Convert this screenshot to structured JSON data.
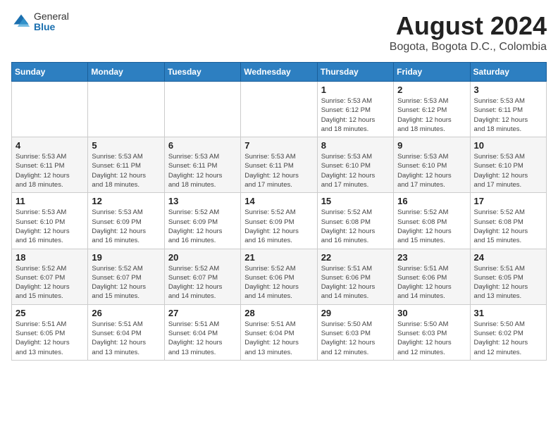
{
  "header": {
    "logo_general": "General",
    "logo_blue": "Blue",
    "main_title": "August 2024",
    "subtitle": "Bogota, Bogota D.C., Colombia"
  },
  "calendar": {
    "days_of_week": [
      "Sunday",
      "Monday",
      "Tuesday",
      "Wednesday",
      "Thursday",
      "Friday",
      "Saturday"
    ],
    "weeks": [
      [
        {
          "day": "",
          "info": ""
        },
        {
          "day": "",
          "info": ""
        },
        {
          "day": "",
          "info": ""
        },
        {
          "day": "",
          "info": ""
        },
        {
          "day": "1",
          "info": "Sunrise: 5:53 AM\nSunset: 6:12 PM\nDaylight: 12 hours\nand 18 minutes."
        },
        {
          "day": "2",
          "info": "Sunrise: 5:53 AM\nSunset: 6:12 PM\nDaylight: 12 hours\nand 18 minutes."
        },
        {
          "day": "3",
          "info": "Sunrise: 5:53 AM\nSunset: 6:11 PM\nDaylight: 12 hours\nand 18 minutes."
        }
      ],
      [
        {
          "day": "4",
          "info": "Sunrise: 5:53 AM\nSunset: 6:11 PM\nDaylight: 12 hours\nand 18 minutes."
        },
        {
          "day": "5",
          "info": "Sunrise: 5:53 AM\nSunset: 6:11 PM\nDaylight: 12 hours\nand 18 minutes."
        },
        {
          "day": "6",
          "info": "Sunrise: 5:53 AM\nSunset: 6:11 PM\nDaylight: 12 hours\nand 18 minutes."
        },
        {
          "day": "7",
          "info": "Sunrise: 5:53 AM\nSunset: 6:11 PM\nDaylight: 12 hours\nand 17 minutes."
        },
        {
          "day": "8",
          "info": "Sunrise: 5:53 AM\nSunset: 6:10 PM\nDaylight: 12 hours\nand 17 minutes."
        },
        {
          "day": "9",
          "info": "Sunrise: 5:53 AM\nSunset: 6:10 PM\nDaylight: 12 hours\nand 17 minutes."
        },
        {
          "day": "10",
          "info": "Sunrise: 5:53 AM\nSunset: 6:10 PM\nDaylight: 12 hours\nand 17 minutes."
        }
      ],
      [
        {
          "day": "11",
          "info": "Sunrise: 5:53 AM\nSunset: 6:10 PM\nDaylight: 12 hours\nand 16 minutes."
        },
        {
          "day": "12",
          "info": "Sunrise: 5:53 AM\nSunset: 6:09 PM\nDaylight: 12 hours\nand 16 minutes."
        },
        {
          "day": "13",
          "info": "Sunrise: 5:52 AM\nSunset: 6:09 PM\nDaylight: 12 hours\nand 16 minutes."
        },
        {
          "day": "14",
          "info": "Sunrise: 5:52 AM\nSunset: 6:09 PM\nDaylight: 12 hours\nand 16 minutes."
        },
        {
          "day": "15",
          "info": "Sunrise: 5:52 AM\nSunset: 6:08 PM\nDaylight: 12 hours\nand 16 minutes."
        },
        {
          "day": "16",
          "info": "Sunrise: 5:52 AM\nSunset: 6:08 PM\nDaylight: 12 hours\nand 15 minutes."
        },
        {
          "day": "17",
          "info": "Sunrise: 5:52 AM\nSunset: 6:08 PM\nDaylight: 12 hours\nand 15 minutes."
        }
      ],
      [
        {
          "day": "18",
          "info": "Sunrise: 5:52 AM\nSunset: 6:07 PM\nDaylight: 12 hours\nand 15 minutes."
        },
        {
          "day": "19",
          "info": "Sunrise: 5:52 AM\nSunset: 6:07 PM\nDaylight: 12 hours\nand 15 minutes."
        },
        {
          "day": "20",
          "info": "Sunrise: 5:52 AM\nSunset: 6:07 PM\nDaylight: 12 hours\nand 14 minutes."
        },
        {
          "day": "21",
          "info": "Sunrise: 5:52 AM\nSunset: 6:06 PM\nDaylight: 12 hours\nand 14 minutes."
        },
        {
          "day": "22",
          "info": "Sunrise: 5:51 AM\nSunset: 6:06 PM\nDaylight: 12 hours\nand 14 minutes."
        },
        {
          "day": "23",
          "info": "Sunrise: 5:51 AM\nSunset: 6:06 PM\nDaylight: 12 hours\nand 14 minutes."
        },
        {
          "day": "24",
          "info": "Sunrise: 5:51 AM\nSunset: 6:05 PM\nDaylight: 12 hours\nand 13 minutes."
        }
      ],
      [
        {
          "day": "25",
          "info": "Sunrise: 5:51 AM\nSunset: 6:05 PM\nDaylight: 12 hours\nand 13 minutes."
        },
        {
          "day": "26",
          "info": "Sunrise: 5:51 AM\nSunset: 6:04 PM\nDaylight: 12 hours\nand 13 minutes."
        },
        {
          "day": "27",
          "info": "Sunrise: 5:51 AM\nSunset: 6:04 PM\nDaylight: 12 hours\nand 13 minutes."
        },
        {
          "day": "28",
          "info": "Sunrise: 5:51 AM\nSunset: 6:04 PM\nDaylight: 12 hours\nand 13 minutes."
        },
        {
          "day": "29",
          "info": "Sunrise: 5:50 AM\nSunset: 6:03 PM\nDaylight: 12 hours\nand 12 minutes."
        },
        {
          "day": "30",
          "info": "Sunrise: 5:50 AM\nSunset: 6:03 PM\nDaylight: 12 hours\nand 12 minutes."
        },
        {
          "day": "31",
          "info": "Sunrise: 5:50 AM\nSunset: 6:02 PM\nDaylight: 12 hours\nand 12 minutes."
        }
      ]
    ]
  }
}
